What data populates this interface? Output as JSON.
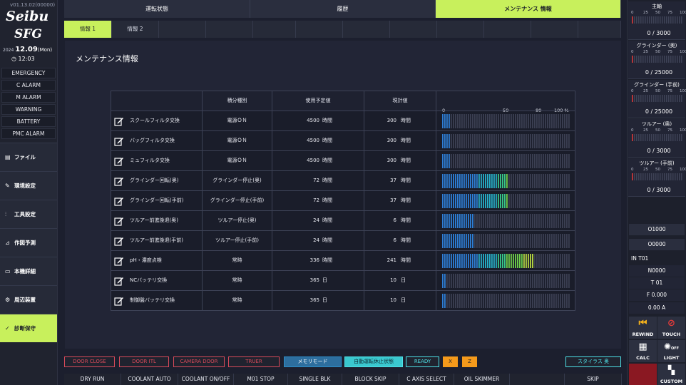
{
  "sidebar": {
    "version": "v01.13.02(00000)",
    "logo_line1": "Seibu",
    "logo_line2": "SFG",
    "year": "2024",
    "date": "12.09",
    "weekday": "(Mon)",
    "time": "12:03",
    "alarms": [
      "EMERGENCY",
      "C ALARM",
      "M ALARM",
      "WARNING",
      "BATTERY",
      "PMC ALARM"
    ],
    "nav": [
      {
        "label": "ファイル",
        "icon": "file-icon"
      },
      {
        "label": "環境設定",
        "icon": "wrench-icon"
      },
      {
        "label": "工具設定",
        "icon": "sliders-icon"
      },
      {
        "label": "作図予測",
        "icon": "chart-icon"
      },
      {
        "label": "本機詳細",
        "icon": "monitor-icon"
      },
      {
        "label": "周辺装置",
        "icon": "gear-icon"
      },
      {
        "label": "診断保守",
        "icon": "check-icon"
      }
    ]
  },
  "tabs": [
    "運転状態",
    "履歴",
    "メンテナンス 情報"
  ],
  "subtabs": [
    "情報 1",
    "情報 2"
  ],
  "panel_title": "メンテナンス情報",
  "table": {
    "headers": [
      "積分種別",
      "使用予定値",
      "現計値"
    ],
    "scale": [
      "0",
      "50",
      "80",
      "100 %"
    ],
    "rows": [
      {
        "name": "スクールフィルタ交換",
        "type": "電源ＯＮ",
        "plan": "4500",
        "plan_unit": "時間",
        "cur": "300",
        "cur_unit": "時間",
        "pct": 6.7
      },
      {
        "name": "バッグフィルタ交換",
        "type": "電源ＯＮ",
        "plan": "4500",
        "plan_unit": "時間",
        "cur": "300",
        "cur_unit": "時間",
        "pct": 6.7
      },
      {
        "name": "ミュフィルタ交換",
        "type": "電源ＯＮ",
        "plan": "4500",
        "plan_unit": "時間",
        "cur": "300",
        "cur_unit": "時間",
        "pct": 6.7
      },
      {
        "name": "グラインダー回転(奥)",
        "type": "グラインダー停止(奥)",
        "plan": "72",
        "plan_unit": "時間",
        "cur": "37",
        "cur_unit": "時間",
        "pct": 51.4
      },
      {
        "name": "グラインダー回転(手前)",
        "type": "グラインダー停止(手前)",
        "plan": "72",
        "plan_unit": "時間",
        "cur": "37",
        "cur_unit": "時間",
        "pct": 51.4
      },
      {
        "name": "ツルアー前進後退(奥)",
        "type": "ツルアー停止(奥)",
        "plan": "24",
        "plan_unit": "時間",
        "cur": "6",
        "cur_unit": "時間",
        "pct": 25
      },
      {
        "name": "ツルアー前進後退(手前)",
        "type": "ツルアー停止(手前)",
        "plan": "24",
        "plan_unit": "時間",
        "cur": "6",
        "cur_unit": "時間",
        "pct": 25
      },
      {
        "name": "pH・濃度点検",
        "type": "常時",
        "plan": "336",
        "plan_unit": "時間",
        "cur": "241",
        "cur_unit": "時間",
        "pct": 71.7
      },
      {
        "name": "NCバッテリ交換",
        "type": "常時",
        "plan": "365",
        "plan_unit": "日",
        "cur": "10",
        "cur_unit": "日",
        "pct": 2.7
      },
      {
        "name": "制御盤バッテリ交換",
        "type": "常時",
        "plan": "365",
        "plan_unit": "日",
        "cur": "10",
        "cur_unit": "日",
        "pct": 2.7
      }
    ]
  },
  "status_buttons": [
    {
      "label": "DOOR CLOSE",
      "color": "#d94a5a"
    },
    {
      "label": "DOOR ITL",
      "color": "#d94a5a"
    },
    {
      "label": "CAMERA DOOR",
      "color": "#d94a5a"
    },
    {
      "label": "TRUER",
      "color": "#d94a5a"
    },
    {
      "label": "メモリモード",
      "color": "#2d8ec9"
    },
    {
      "label": "自動運転休止状態",
      "color": "#4ee0e6"
    },
    {
      "label": "READY",
      "color": "#4ee0e6"
    },
    {
      "label": "X",
      "color": "#f59a1b"
    },
    {
      "label": "Z",
      "color": "#f59a1b"
    },
    {
      "label": "スタイラス 奥",
      "color": "#4ee0e6"
    }
  ],
  "function_keys": [
    "DRY RUN",
    "COOLANT AUTO",
    "COOLANT ON/OFF",
    "M01 STOP",
    "SINGLE BLK",
    "BLOCK SKIP",
    "C AXIS SELECT",
    "OIL SKIMMER",
    "SKIP"
  ],
  "gauges": [
    {
      "title": "主軸",
      "ticks": [
        "0",
        "25",
        "50",
        "75",
        "100"
      ],
      "value": "0 / 3000"
    },
    {
      "title": "グラインダー (奥)",
      "ticks": [
        "0",
        "25",
        "50",
        "75",
        "100"
      ],
      "value": "0 / 25000"
    },
    {
      "title": "グラインダー (手前)",
      "ticks": [
        "0",
        "25",
        "50",
        "75",
        "100"
      ],
      "value": "0 / 25000"
    },
    {
      "title": "ツルアー (奥)",
      "ticks": [
        "0",
        "25",
        "50",
        "75",
        "100"
      ],
      "value": "0 / 3000"
    },
    {
      "title": "ツルアー (手前)",
      "ticks": [
        "0",
        "25",
        "50",
        "75",
        "100"
      ],
      "value": "0 / 3000"
    }
  ],
  "right_info": {
    "prog1": "O1000",
    "prog2": "O0000",
    "tool_line": "IN T01",
    "seq": "N0000",
    "tool": "T 01",
    "feed": "F 0.000",
    "amp": "0.00 A"
  },
  "tool_buttons": [
    "REWIND",
    "TOUCH",
    "CALC",
    "LIGHT",
    "CUSTOM"
  ],
  "light_state": "OFF"
}
